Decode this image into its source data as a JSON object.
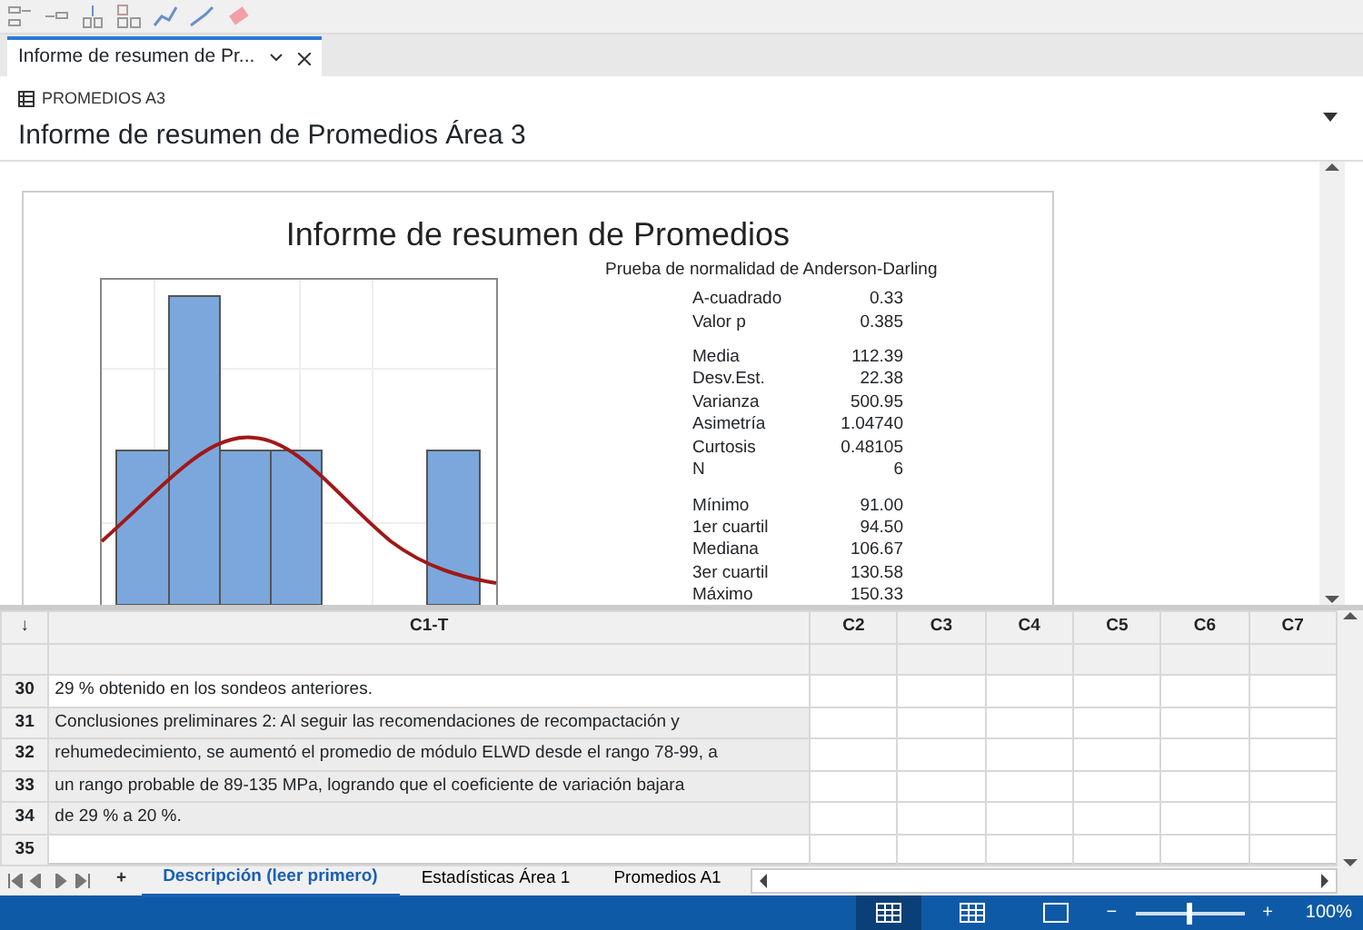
{
  "document_tab": {
    "label": "Informe de resumen de Pr..."
  },
  "header": {
    "breadcrumb": "PROMEDIOS A3",
    "title": "Informe de resumen de Promedios Área 3"
  },
  "report": {
    "title": "Informe de resumen de Promedios",
    "test_title": "Prueba de normalidad de Anderson-Darling",
    "stat_groups": [
      [
        {
          "label": "A-cuadrado",
          "value": "0.33"
        },
        {
          "label": "Valor p",
          "value": "0.385"
        }
      ],
      [
        {
          "label": "Media",
          "value": "112.39"
        },
        {
          "label": "Desv.Est.",
          "value": "22.38"
        },
        {
          "label": "Varianza",
          "value": "500.95"
        },
        {
          "label": "Asimetría",
          "value": "1.04740"
        },
        {
          "label": "Curtosis",
          "value": "0.48105"
        },
        {
          "label": "N",
          "value": "6"
        }
      ],
      [
        {
          "label": "Mínimo",
          "value": "91.00"
        },
        {
          "label": "1er cuartil",
          "value": "94.50"
        },
        {
          "label": "Mediana",
          "value": "106.67"
        },
        {
          "label": "3er cuartil",
          "value": "130.58"
        },
        {
          "label": "Máximo",
          "value": "150.33"
        }
      ]
    ]
  },
  "worksheet": {
    "corner": "↓",
    "columns": [
      "C1-T",
      "C2",
      "C3",
      "C4",
      "C5",
      "C6",
      "C7"
    ],
    "rows": [
      {
        "number": "30",
        "text": "29 % obtenido en los sondeos anteriores.",
        "selected": false
      },
      {
        "number": "31",
        "text": "Conclusiones preliminares 2: Al seguir las recomendaciones de recompactación y",
        "selected": true
      },
      {
        "number": "32",
        "text": "rehumedecimiento, se aumentó el promedio de módulo ELWD desde el rango 78-99, a",
        "selected": true
      },
      {
        "number": "33",
        "text": "un rango probable de 89-135 MPa, logrando que el coeficiente de variación bajara",
        "selected": true
      },
      {
        "number": "34",
        "text": "de 29 % a 20 %.",
        "selected": true
      },
      {
        "number": "35",
        "text": "",
        "selected": false
      }
    ]
  },
  "sheet_tabs": [
    {
      "label": "Descripción (leer primero)",
      "selected": true
    },
    {
      "label": "Estadísticas Área 1",
      "selected": false
    },
    {
      "label": "Promedios A1",
      "selected": false
    }
  ],
  "add_sheet": "+",
  "status_bar": {
    "zoom_minus": "−",
    "zoom_plus": "+",
    "zoom": "100%",
    "zoom_slider": {
      "level": 0.5
    }
  }
}
